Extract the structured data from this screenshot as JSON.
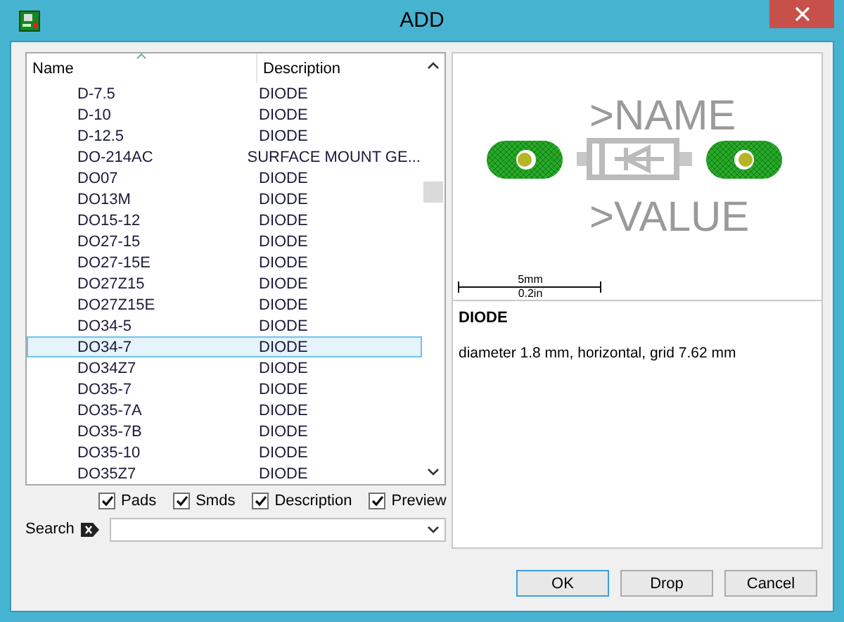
{
  "window": {
    "title": "ADD"
  },
  "table": {
    "columns": [
      "Name",
      "Description"
    ],
    "rows": [
      {
        "name": "D-7.5",
        "description": "DIODE",
        "selected": false
      },
      {
        "name": "D-10",
        "description": "DIODE",
        "selected": false
      },
      {
        "name": "D-12.5",
        "description": "DIODE",
        "selected": false
      },
      {
        "name": "DO-214AC",
        "description": "SURFACE MOUNT GE...",
        "selected": false
      },
      {
        "name": "DO07",
        "description": "DIODE",
        "selected": false
      },
      {
        "name": "DO13M",
        "description": "DIODE",
        "selected": false
      },
      {
        "name": "DO15-12",
        "description": "DIODE",
        "selected": false
      },
      {
        "name": "DO27-15",
        "description": "DIODE",
        "selected": false
      },
      {
        "name": "DO27-15E",
        "description": "DIODE",
        "selected": false
      },
      {
        "name": "DO27Z15",
        "description": "DIODE",
        "selected": false
      },
      {
        "name": "DO27Z15E",
        "description": "DIODE",
        "selected": false
      },
      {
        "name": "DO34-5",
        "description": "DIODE",
        "selected": false
      },
      {
        "name": "DO34-7",
        "description": "DIODE",
        "selected": true
      },
      {
        "name": "DO34Z7",
        "description": "DIODE",
        "selected": false
      },
      {
        "name": "DO35-7",
        "description": "DIODE",
        "selected": false
      },
      {
        "name": "DO35-7A",
        "description": "DIODE",
        "selected": false
      },
      {
        "name": "DO35-7B",
        "description": "DIODE",
        "selected": false
      },
      {
        "name": "DO35-10",
        "description": "DIODE",
        "selected": false
      },
      {
        "name": "DO35Z7",
        "description": "DIODE",
        "selected": false
      }
    ]
  },
  "options": [
    {
      "label": "Pads",
      "checked": true
    },
    {
      "label": "Smds",
      "checked": true
    },
    {
      "label": "Description",
      "checked": true
    },
    {
      "label": "Preview",
      "checked": true
    }
  ],
  "search": {
    "label": "Search"
  },
  "preview": {
    "name_label": ">NAME",
    "value_label": ">VALUE",
    "scale_metric": "5mm",
    "scale_imperial": "0.2in"
  },
  "description": {
    "title": "DIODE",
    "text": "diameter 1.8 mm, horizontal, grid 7.62 mm"
  },
  "buttons": [
    "OK",
    "Drop",
    "Cancel"
  ]
}
